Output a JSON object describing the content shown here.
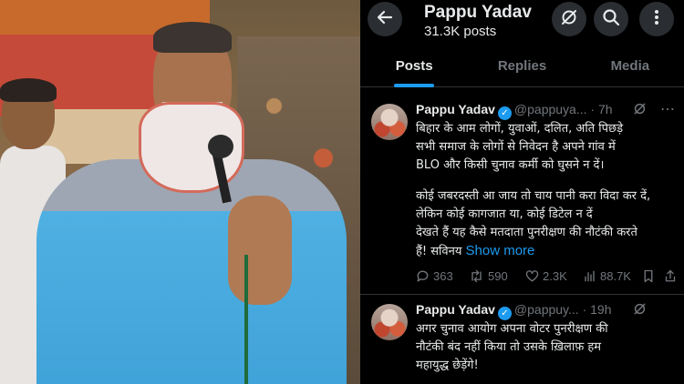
{
  "profile": {
    "name": "Pappu Yadav",
    "post_count": "31.3K posts",
    "icons": [
      "back-arrow-icon",
      "grok-icon",
      "search-icon",
      "more-vertical-icon"
    ]
  },
  "tabs": [
    {
      "label": "Posts",
      "active": true
    },
    {
      "label": "Replies",
      "active": false
    },
    {
      "label": "Media",
      "active": false
    }
  ],
  "tweets": [
    {
      "name": "Pappu Yadav",
      "handle": "@pappuya...",
      "separator": "·",
      "time": "7h",
      "text_lines_1": [
        "बिहार के आम लोगों, युवाओं, दलित, अति पिछड़े",
        "सभी समाज के लोगों से निवेदन है अपने गांव में",
        "BLO और किसी चुनाव कर्मी को घुसने न दें।"
      ],
      "text_lines_2": [
        "कोई जबरदस्ती आ जाय तो चाय पानी करा विदा कर दें,",
        "लेकिन कोई कागजात या, कोई डिटेल न दें",
        "देखते हैं यह कैसे मतदाता पुनरीक्षण की नौटंकी करते"
      ],
      "last_line": "हैं! सविनय",
      "show_more": "Show more",
      "replies": "363",
      "reposts": "590",
      "likes": "2.3K",
      "views": "88.7K"
    },
    {
      "name": "Pappu Yadav",
      "handle": "@pappuy...",
      "separator": "·",
      "time": "19h",
      "text_lines": [
        "अगर चुनाव आयोग अपना वोटर पुनरीक्षण की",
        "नौटंकी बंद नहीं किया तो उसके ख़िलाफ़ हम",
        "महायुद्ध छेड़ेंगे!"
      ]
    }
  ],
  "colors": {
    "accent": "#1d9bf0",
    "muted": "#71767b",
    "text": "#e7e9ea",
    "background": "#000000"
  }
}
